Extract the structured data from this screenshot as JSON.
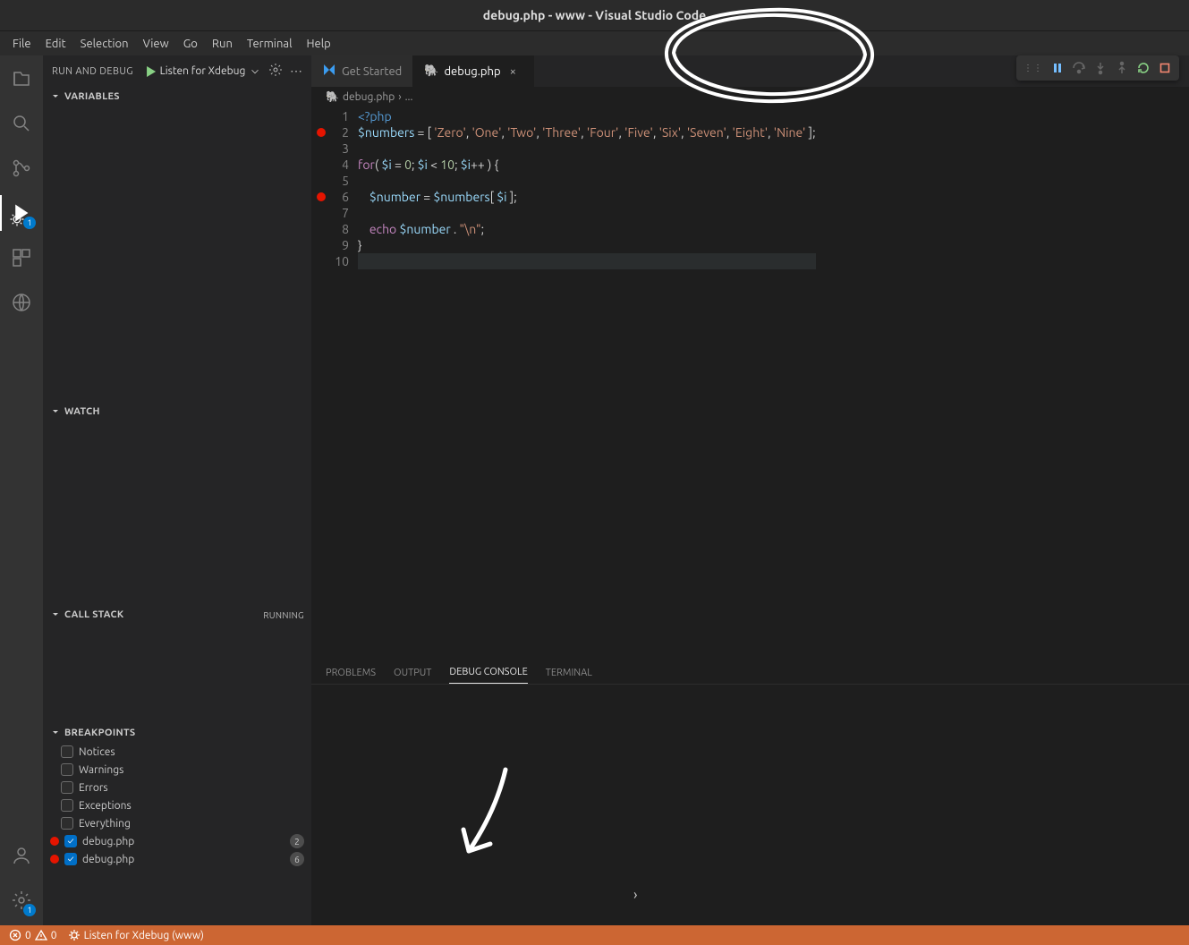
{
  "title": "debug.php - www - Visual Studio Code",
  "menu": [
    "File",
    "Edit",
    "Selection",
    "View",
    "Go",
    "Run",
    "Terminal",
    "Help"
  ],
  "sidebar": {
    "title": "RUN AND DEBUG",
    "config": "Listen for Xdebug",
    "sections": {
      "variables": "VARIABLES",
      "watch": "WATCH",
      "callstack": "CALL STACK",
      "callstack_status": "RUNNING",
      "breakpoints": "BREAKPOINTS"
    },
    "bp_categories": [
      {
        "label": "Notices",
        "checked": false
      },
      {
        "label": "Warnings",
        "checked": false
      },
      {
        "label": "Errors",
        "checked": false
      },
      {
        "label": "Exceptions",
        "checked": false
      },
      {
        "label": "Everything",
        "checked": false
      }
    ],
    "bp_files": [
      {
        "label": "debug.php",
        "checked": true,
        "count": "2"
      },
      {
        "label": "debug.php",
        "checked": true,
        "count": "6"
      }
    ]
  },
  "tabs": [
    {
      "label": "Get Started",
      "active": false,
      "kind": "vscode"
    },
    {
      "label": "debug.php",
      "active": true,
      "kind": "php"
    }
  ],
  "breadcrumb": {
    "file": "debug.php",
    "tail": "..."
  },
  "lines": [
    {
      "n": "1",
      "bp": false,
      "html": "<span class='tok-tag'>&lt;?php</span>"
    },
    {
      "n": "2",
      "bp": true,
      "html": "<span class='tok-var'>$numbers</span> <span class='tok-pn'>= [ </span><span class='tok-str'>'Zero'</span>, <span class='tok-str'>'One'</span>, <span class='tok-str'>'Two'</span>, <span class='tok-str'>'Three'</span>, <span class='tok-str'>'Four'</span>, <span class='tok-str'>'Five'</span>, <span class='tok-str'>'Six'</span>, <span class='tok-str'>'Seven'</span>, <span class='tok-str'>'Eight'</span>, <span class='tok-str'>'Nine'</span> ];"
    },
    {
      "n": "3",
      "bp": false,
      "html": ""
    },
    {
      "n": "4",
      "bp": false,
      "html": "<span class='tok-kw'>for</span>( <span class='tok-var'>$i</span> = <span class='tok-num'>0</span>; <span class='tok-var'>$i</span> &lt; <span class='tok-num'>10</span>; <span class='tok-var'>$i</span>++ ) {"
    },
    {
      "n": "5",
      "bp": false,
      "html": ""
    },
    {
      "n": "6",
      "bp": true,
      "html": "    <span class='tok-var'>$number</span> = <span class='tok-var'>$numbers</span>[ <span class='tok-var'>$i</span> ];"
    },
    {
      "n": "7",
      "bp": false,
      "html": ""
    },
    {
      "n": "8",
      "bp": false,
      "html": "    <span class='tok-kw'>echo</span> <span class='tok-var'>$number</span> . <span class='tok-str'>\"\\n\"</span>;"
    },
    {
      "n": "9",
      "bp": false,
      "html": "}"
    },
    {
      "n": "10",
      "bp": false,
      "html": "",
      "current": true
    }
  ],
  "panel": {
    "tabs": [
      "PROBLEMS",
      "OUTPUT",
      "DEBUG CONSOLE",
      "TERMINAL"
    ],
    "active": 2
  },
  "status": {
    "errors": "0",
    "warnings": "0",
    "debug": "Listen for Xdebug (www)"
  },
  "activity_badge": "1",
  "settings_badge": "1"
}
